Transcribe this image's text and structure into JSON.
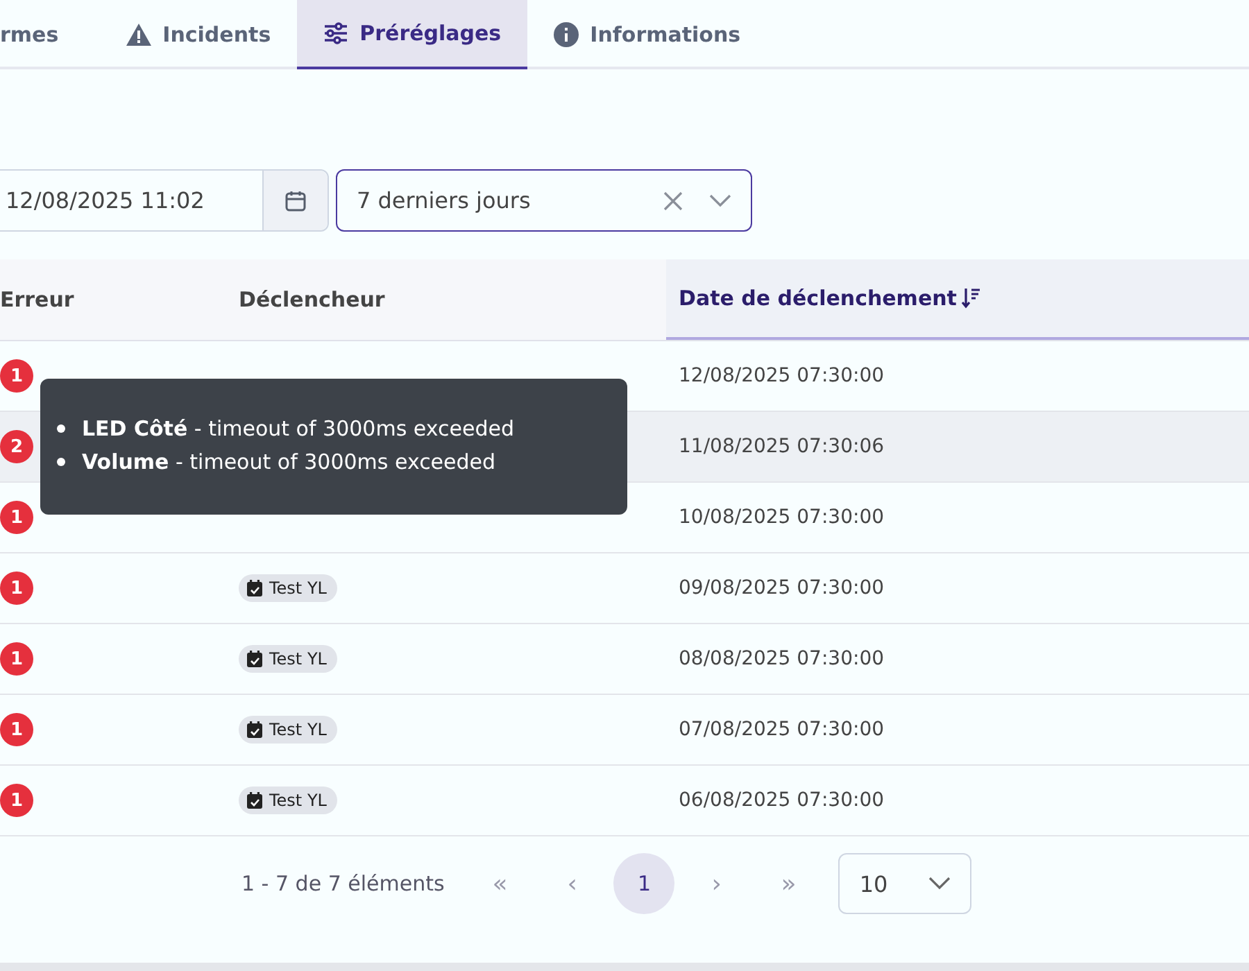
{
  "tabs": [
    {
      "label": "rmes",
      "selected": false
    },
    {
      "label": "Incidents",
      "selected": false
    },
    {
      "label": "Préréglages",
      "selected": true
    },
    {
      "label": "Informations",
      "selected": false
    }
  ],
  "filters": {
    "date_value": "12/08/2025 11:02",
    "period_value": "7 derniers jours"
  },
  "table": {
    "columns": [
      {
        "label": "Erreur",
        "sorted": false
      },
      {
        "label": "Déclencheur",
        "sorted": false
      },
      {
        "label": "Date de déclenchement",
        "sorted": true
      }
    ],
    "rows": [
      {
        "errors": "1",
        "date": "12/08/2025 07:30:00",
        "selected": false
      },
      {
        "errors": "2",
        "date": "11/08/2025 07:30:06",
        "selected": true
      },
      {
        "errors": "1",
        "date": "10/08/2025 07:30:00",
        "selected": false
      },
      {
        "errors": "1",
        "trigger": "Test YL",
        "date": "09/08/2025 07:30:00",
        "selected": false
      },
      {
        "errors": "1",
        "trigger": "Test YL",
        "date": "08/08/2025 07:30:00",
        "selected": false
      },
      {
        "errors": "1",
        "trigger": "Test YL",
        "date": "07/08/2025 07:30:00",
        "selected": false
      },
      {
        "errors": "1",
        "trigger": "Test YL",
        "date": "06/08/2025 07:30:00",
        "selected": false
      }
    ]
  },
  "tooltip": {
    "items": [
      "**LED Côté** - timeout of 3000ms exceeded",
      "**Volume** - timeout of 3000ms exceeded"
    ]
  },
  "pagination": {
    "summary": "1 - 7 de 7 éléments",
    "first": "«",
    "prev": "‹",
    "pages": [
      {
        "label": "1",
        "selected": true
      }
    ],
    "next": "›",
    "last": "»",
    "page_size": "10"
  }
}
